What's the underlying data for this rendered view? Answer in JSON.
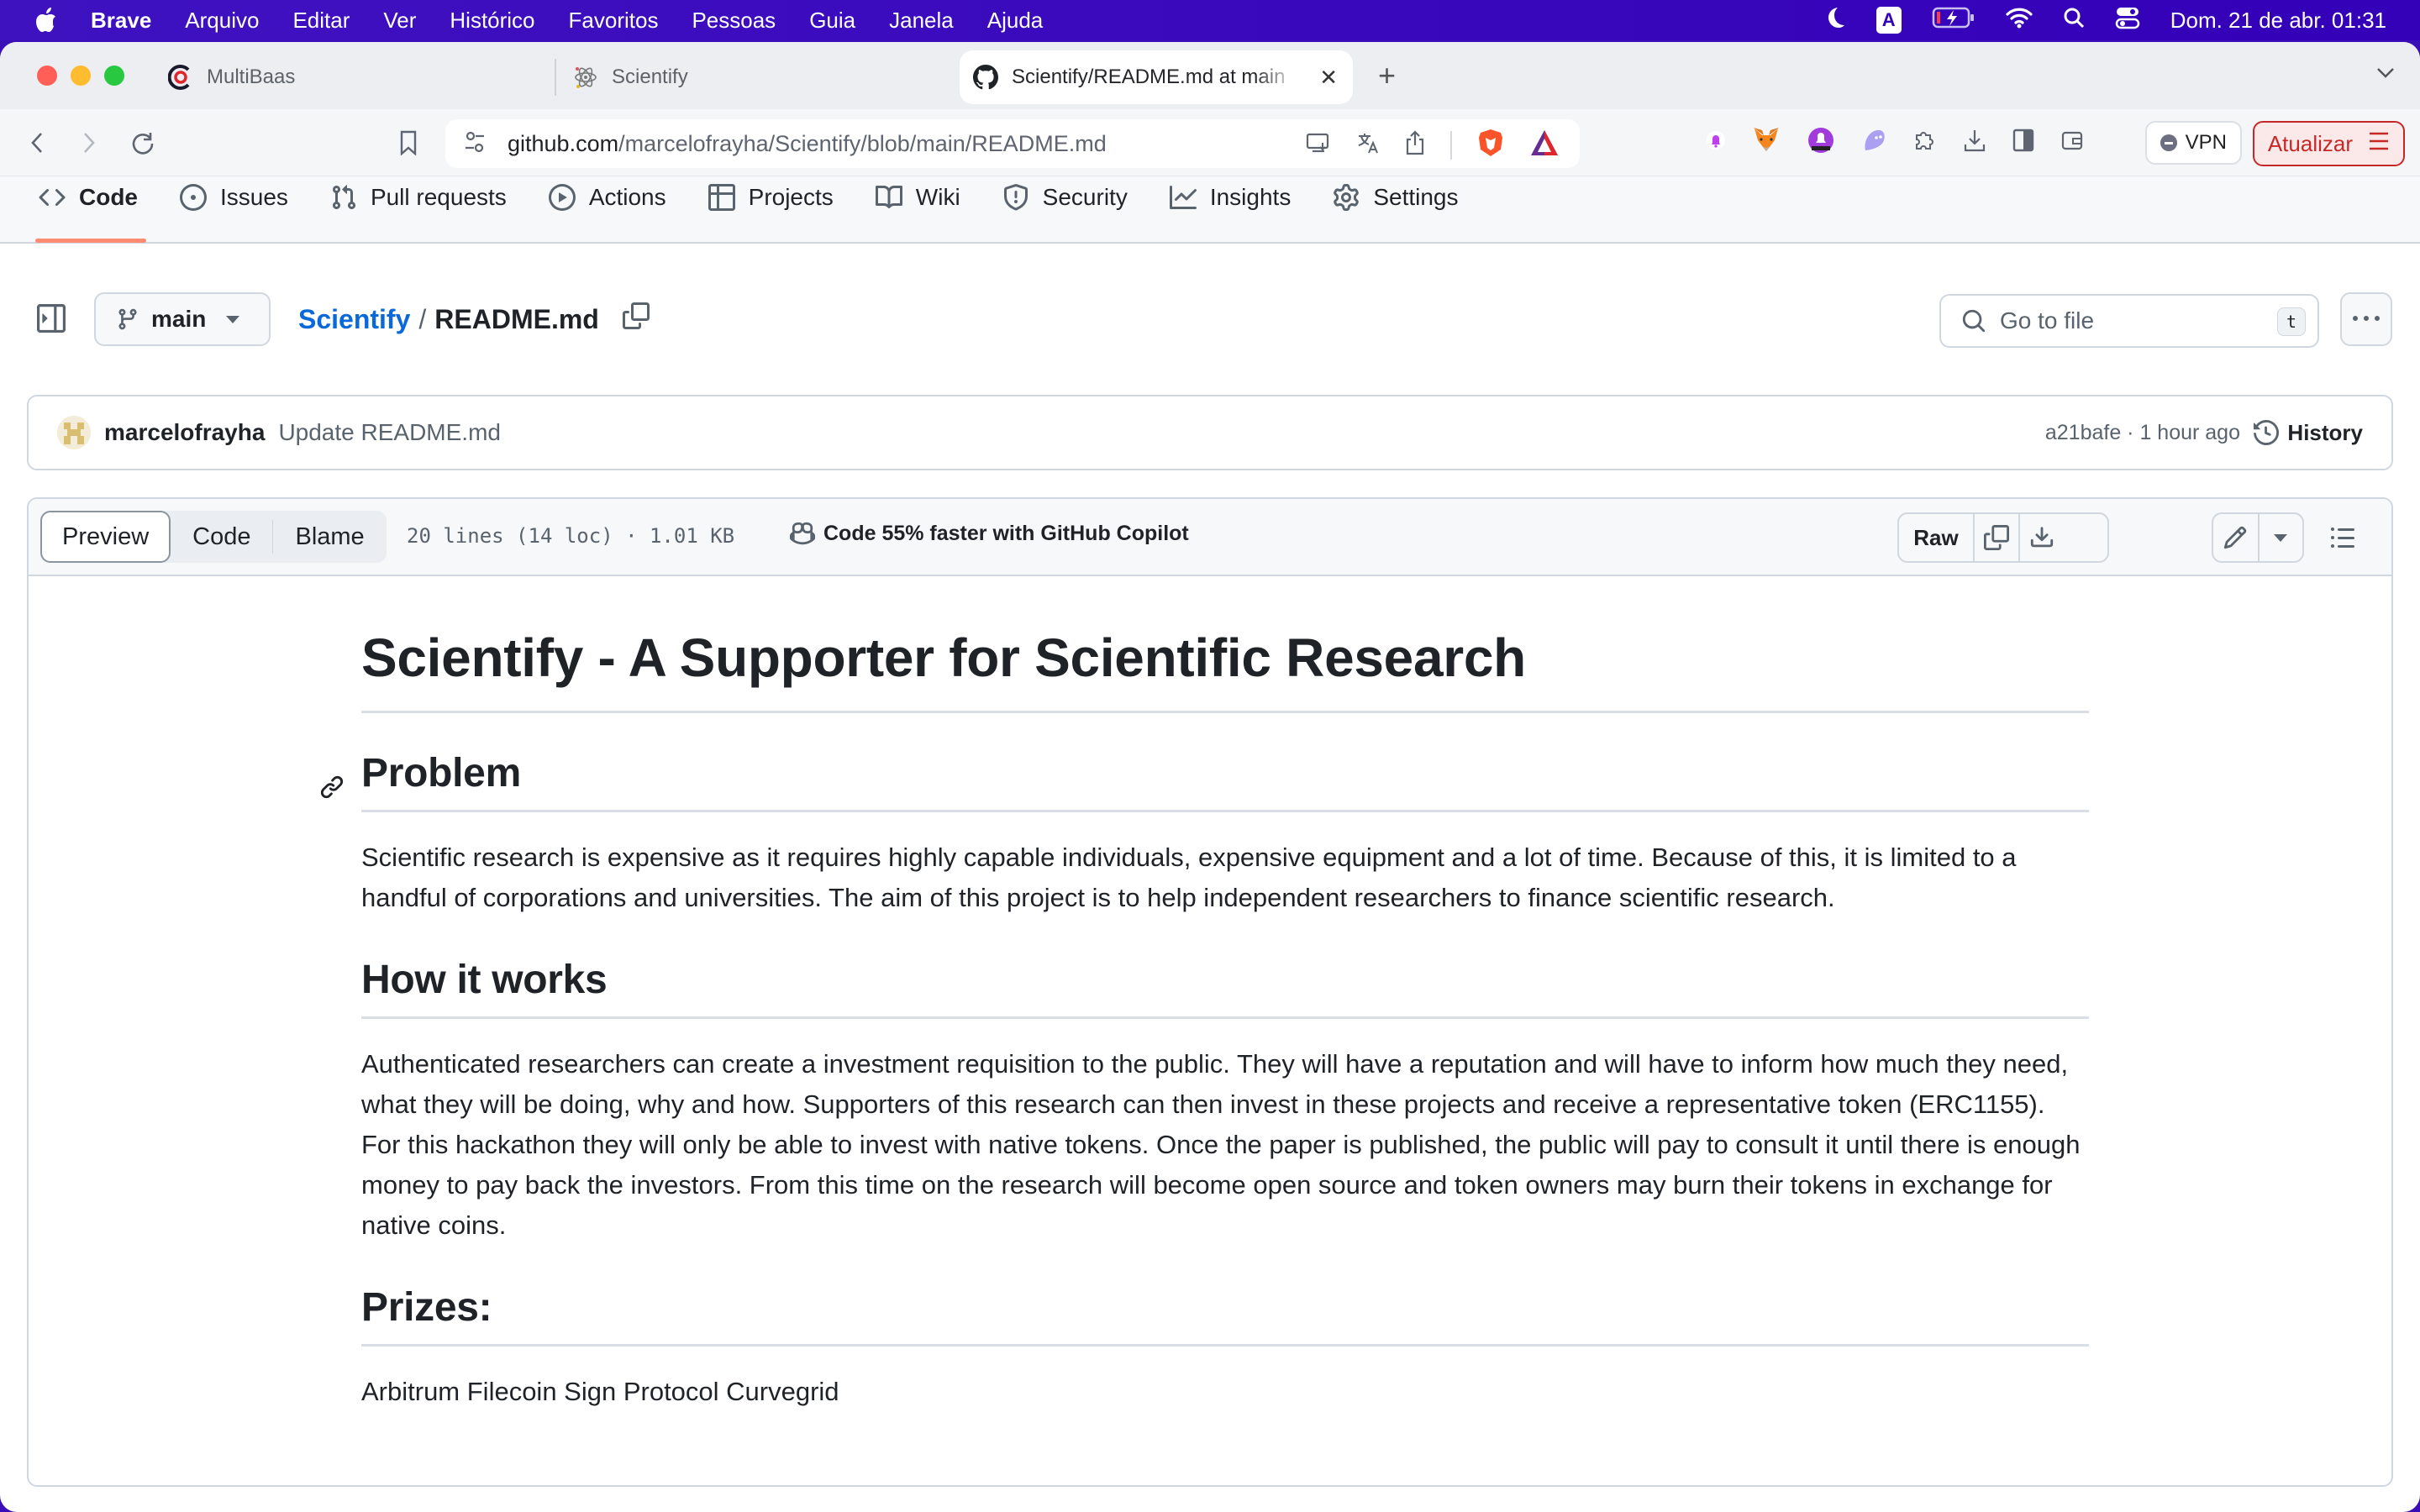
{
  "menubar": {
    "app": "Brave",
    "items": [
      "Arquivo",
      "Editar",
      "Ver",
      "Histórico",
      "Favoritos",
      "Pessoas",
      "Guia",
      "Janela",
      "Ajuda"
    ],
    "input_source": "A",
    "clock": "Dom. 21 de abr. 01:31"
  },
  "tabs": [
    {
      "label": "MultiBaas",
      "icon": "multibaas-icon"
    },
    {
      "label": "Scientify",
      "icon": "atom-icon"
    },
    {
      "label": "Scientify/README.md at main",
      "icon": "github-icon",
      "active": true
    }
  ],
  "toolbar": {
    "url_domain": "github.com",
    "url_path": "/marcelofrayha/Scientify/blob/main/README.md",
    "vpn_label": "VPN",
    "update_label": "Atualizar"
  },
  "repo_nav": {
    "items": [
      {
        "label": "Code",
        "icon": "code-icon",
        "active": true
      },
      {
        "label": "Issues",
        "icon": "issue-icon"
      },
      {
        "label": "Pull requests",
        "icon": "pull-request-icon"
      },
      {
        "label": "Actions",
        "icon": "play-icon"
      },
      {
        "label": "Projects",
        "icon": "table-icon"
      },
      {
        "label": "Wiki",
        "icon": "book-icon"
      },
      {
        "label": "Security",
        "icon": "shield-icon"
      },
      {
        "label": "Insights",
        "icon": "graph-icon"
      },
      {
        "label": "Settings",
        "icon": "gear-icon"
      }
    ]
  },
  "file_header": {
    "branch": "main",
    "repo": "Scientify",
    "separator": "/",
    "file": "README.md",
    "goto_placeholder": "Go to file",
    "goto_shortcut": "t"
  },
  "commit": {
    "author": "marcelofrayha",
    "message": "Update README.md",
    "meta": "a21bafe · 1 hour ago",
    "history_label": "History"
  },
  "file_bar": {
    "views": [
      "Preview",
      "Code",
      "Blame"
    ],
    "active_view": "Preview",
    "info": "20 lines (14 loc) · 1.01 KB",
    "copilot": "Code 55% faster with GitHub Copilot",
    "raw_label": "Raw"
  },
  "readme": {
    "title": "Scientify - A Supporter for Scientific Research",
    "sections": [
      {
        "heading": "Problem",
        "body": "Scientific research is expensive as it requires highly capable individuals, expensive equipment and a lot of time. Because of this, it is limited to a handful of corporations and universities. The aim of this project is to help independent researchers to finance scientific research."
      },
      {
        "heading": "How it works",
        "body": "Authenticated researchers can create a investment requisition to the public. They will have a reputation and will have to inform how much they need, what they will be doing, why and how. Supporters of this research can then invest in these projects and receive a representative token (ERC1155). For this hackathon they will only be able to invest with native tokens. Once the paper is published, the public will pay to consult it until there is enough money to pay back the investors. From this time on the research will become open source and token owners may burn their tokens in exchange for native coins."
      },
      {
        "heading": "Prizes:",
        "body": "Arbitrum Filecoin Sign Protocol Curvegrid"
      }
    ]
  },
  "colors": {
    "link": "#0969da",
    "active_tab_underline": "#fd8c73",
    "update_accent": "#c62828",
    "menubar_bg": "#3400b8"
  }
}
